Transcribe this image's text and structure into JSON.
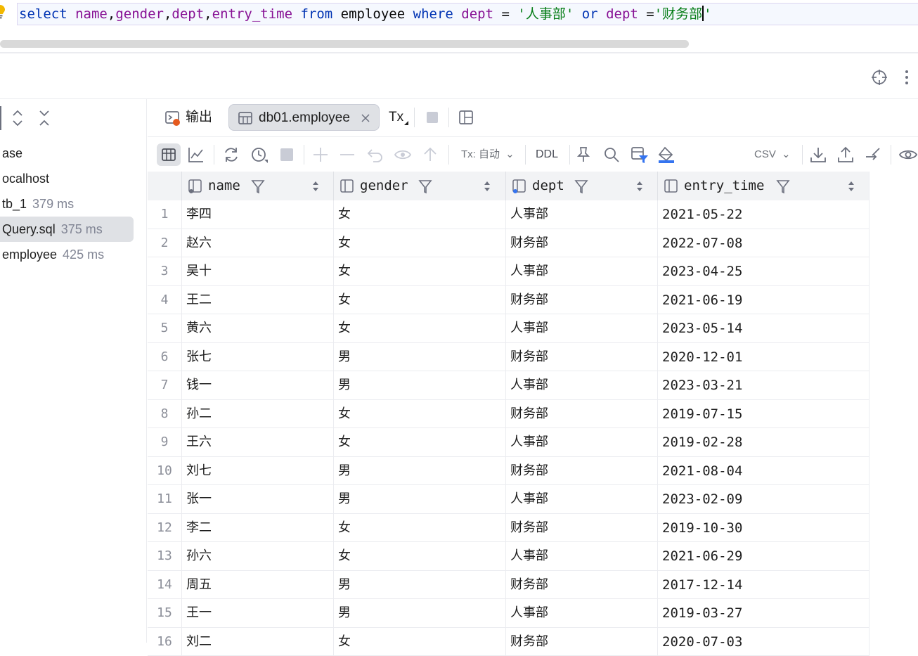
{
  "editor": {
    "sql_tokens": [
      {
        "t": "select",
        "c": "kw"
      },
      {
        "t": " ",
        "c": "plain"
      },
      {
        "t": "name",
        "c": "fld"
      },
      {
        "t": ",",
        "c": "plain"
      },
      {
        "t": "gender",
        "c": "fld"
      },
      {
        "t": ",",
        "c": "plain"
      },
      {
        "t": "dept",
        "c": "fld"
      },
      {
        "t": ",",
        "c": "plain"
      },
      {
        "t": "entry_time",
        "c": "fld"
      },
      {
        "t": " ",
        "c": "plain"
      },
      {
        "t": "from",
        "c": "kw"
      },
      {
        "t": " employee ",
        "c": "plain"
      },
      {
        "t": "where",
        "c": "kw"
      },
      {
        "t": " ",
        "c": "plain"
      },
      {
        "t": "dept",
        "c": "fld"
      },
      {
        "t": " = ",
        "c": "plain"
      },
      {
        "t": "'人事部'",
        "c": "str"
      },
      {
        "t": " ",
        "c": "plain"
      },
      {
        "t": "or",
        "c": "kw"
      },
      {
        "t": " ",
        "c": "plain"
      },
      {
        "t": "dept",
        "c": "fld"
      },
      {
        "t": " =",
        "c": "plain"
      },
      {
        "t": "'财务部",
        "c": "str"
      },
      {
        "t": "CARET",
        "c": "caret"
      },
      {
        "t": "'",
        "c": "str"
      }
    ]
  },
  "tree": {
    "items": [
      {
        "label": "ase",
        "ms": ""
      },
      {
        "label": "ocalhost",
        "ms": ""
      },
      {
        "label": "tb_1",
        "ms": "379 ms"
      },
      {
        "label": "Query.sql",
        "ms": "375 ms",
        "selected": true
      },
      {
        "label": "employee",
        "ms": "425 ms"
      }
    ]
  },
  "tabs": {
    "output_label": "输出",
    "table_tab_label": "db01.employee",
    "tx_label": "Tx"
  },
  "toolbar": {
    "tx_mode": "Tx: 自动",
    "ddl_label": "DDL",
    "export_format": "CSV"
  },
  "grid": {
    "columns": [
      "name",
      "gender",
      "dept",
      "entry_time"
    ],
    "rows": [
      {
        "n": "1",
        "name": "李四",
        "gender": "女",
        "dept": "人事部",
        "entry_time": "2021-05-22"
      },
      {
        "n": "2",
        "name": "赵六",
        "gender": "女",
        "dept": "财务部",
        "entry_time": "2022-07-08"
      },
      {
        "n": "3",
        "name": "吴十",
        "gender": "女",
        "dept": "人事部",
        "entry_time": "2023-04-25"
      },
      {
        "n": "4",
        "name": "王二",
        "gender": "女",
        "dept": "财务部",
        "entry_time": "2021-06-19"
      },
      {
        "n": "5",
        "name": "黄六",
        "gender": "女",
        "dept": "人事部",
        "entry_time": "2023-05-14"
      },
      {
        "n": "6",
        "name": "张七",
        "gender": "男",
        "dept": "财务部",
        "entry_time": "2020-12-01"
      },
      {
        "n": "7",
        "name": "钱一",
        "gender": "男",
        "dept": "人事部",
        "entry_time": "2023-03-21"
      },
      {
        "n": "8",
        "name": "孙二",
        "gender": "女",
        "dept": "财务部",
        "entry_time": "2019-07-15"
      },
      {
        "n": "9",
        "name": "王六",
        "gender": "女",
        "dept": "人事部",
        "entry_time": "2019-02-28"
      },
      {
        "n": "10",
        "name": "刘七",
        "gender": "男",
        "dept": "财务部",
        "entry_time": "2021-08-04"
      },
      {
        "n": "11",
        "name": "张一",
        "gender": "男",
        "dept": "人事部",
        "entry_time": "2023-02-09"
      },
      {
        "n": "12",
        "name": "李二",
        "gender": "女",
        "dept": "财务部",
        "entry_time": "2019-10-30"
      },
      {
        "n": "13",
        "name": "孙六",
        "gender": "女",
        "dept": "人事部",
        "entry_time": "2021-06-29"
      },
      {
        "n": "14",
        "name": "周五",
        "gender": "男",
        "dept": "财务部",
        "entry_time": "2017-12-14"
      },
      {
        "n": "15",
        "name": "王一",
        "gender": "男",
        "dept": "人事部",
        "entry_time": "2019-03-27"
      },
      {
        "n": "16",
        "name": "刘二",
        "gender": "女",
        "dept": "财务部",
        "entry_time": "2020-07-03"
      }
    ]
  },
  "colors": {
    "keyword": "#0033b3",
    "field": "#871094",
    "string": "#067d17",
    "bulb": "#f2b800",
    "accent": "#3574f0"
  }
}
